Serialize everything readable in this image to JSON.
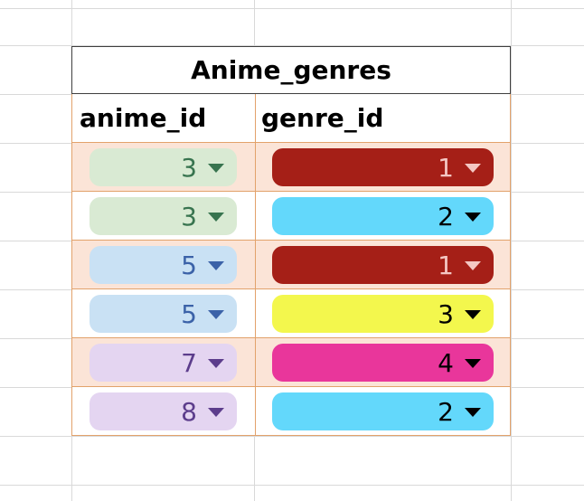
{
  "table": {
    "title": "Anime_genres",
    "headers": {
      "anime_id": "anime_id",
      "genre_id": "genre_id"
    },
    "rows": [
      {
        "anime_id": "3",
        "genre_id": "1",
        "anime_bg": "#d9ead3",
        "anime_fg": "#38744f",
        "genre_bg": "#a51f17",
        "genre_fg": "#f4c7c3",
        "shaded": true
      },
      {
        "anime_id": "3",
        "genre_id": "2",
        "anime_bg": "#d9ead3",
        "anime_fg": "#38744f",
        "genre_bg": "#63d8fb",
        "genre_fg": "#000000",
        "shaded": false
      },
      {
        "anime_id": "5",
        "genre_id": "1",
        "anime_bg": "#c9e1f4",
        "anime_fg": "#3b62a8",
        "genre_bg": "#a51f17",
        "genre_fg": "#f4c7c3",
        "shaded": true
      },
      {
        "anime_id": "5",
        "genre_id": "3",
        "anime_bg": "#c9e1f4",
        "anime_fg": "#3b62a8",
        "genre_bg": "#f3f74d",
        "genre_fg": "#000000",
        "shaded": false
      },
      {
        "anime_id": "7",
        "genre_id": "4",
        "anime_bg": "#e4d5f1",
        "anime_fg": "#5c3d8c",
        "genre_bg": "#e9369b",
        "genre_fg": "#000000",
        "shaded": true
      },
      {
        "anime_id": "8",
        "genre_id": "2",
        "anime_bg": "#e4d5f1",
        "anime_fg": "#5c3d8c",
        "genre_bg": "#63d8fb",
        "genre_fg": "#000000",
        "shaded": false
      }
    ]
  },
  "colors": {
    "grid_line": "#d9d9d9",
    "title_border": "#3f3f3f",
    "table_border": "#e2a26b",
    "row_shade": "#fbe4d7"
  }
}
